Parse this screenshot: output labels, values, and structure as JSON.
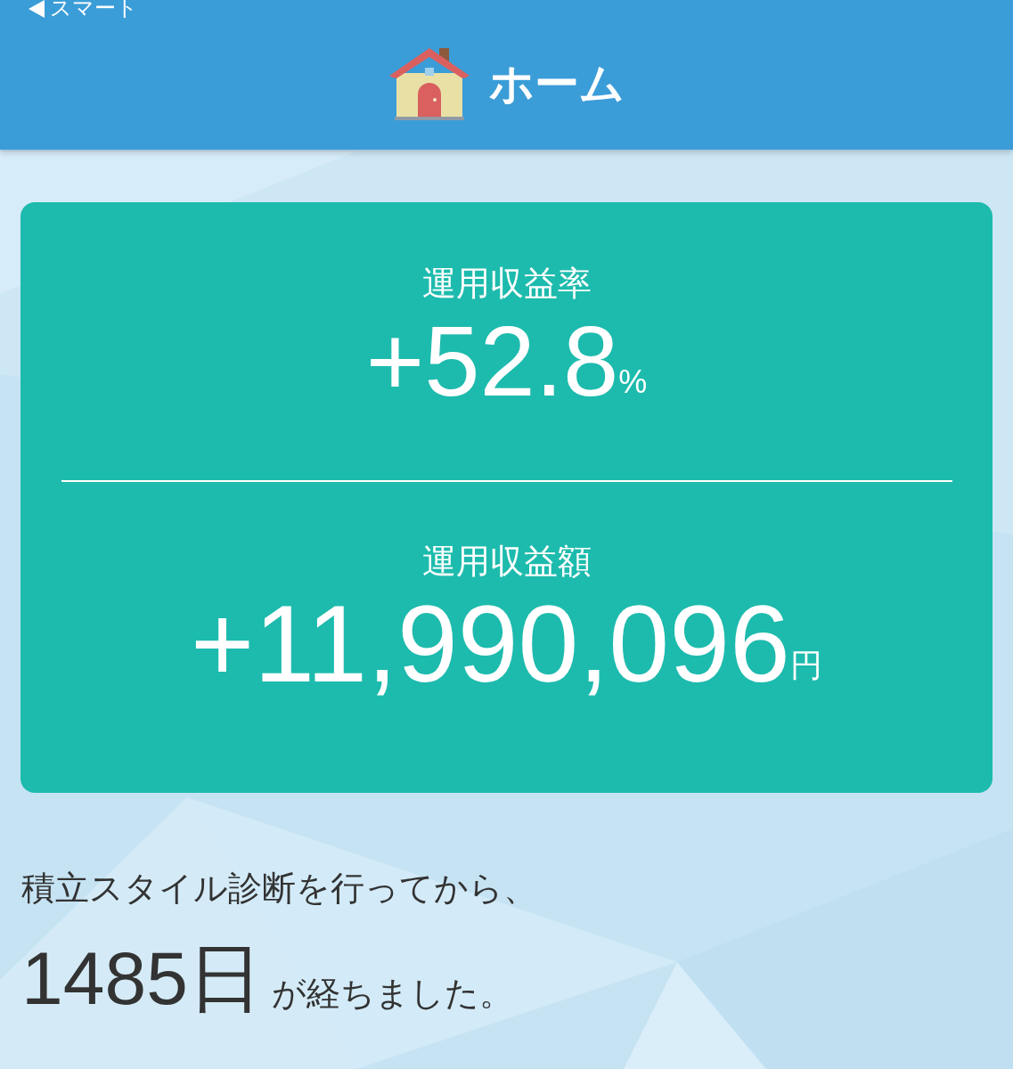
{
  "header": {
    "back_link": "スマート",
    "title": "ホーム"
  },
  "summary": [
    {
      "label": "運用収益率",
      "value": "+52.8",
      "unit": "%"
    },
    {
      "label": "運用収益額",
      "value": "+11,990,096",
      "unit": "円"
    }
  ],
  "elapsed": {
    "intro": "積立スタイル診断を行ってから、",
    "days": "1485",
    "days_unit": "日",
    "suffix": "が経ちました。"
  }
}
